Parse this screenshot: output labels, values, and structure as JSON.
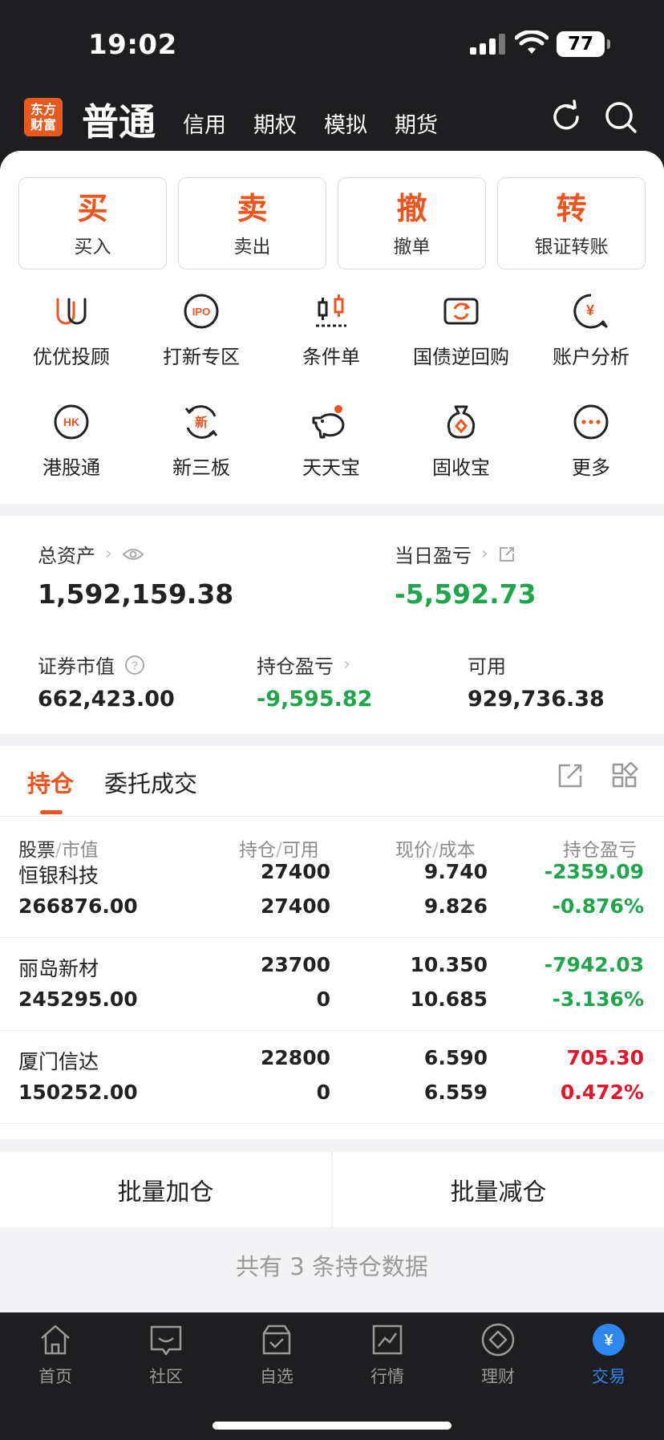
{
  "status": {
    "time": "19:02",
    "battery": "77"
  },
  "header": {
    "logo": [
      "东方",
      "财富"
    ],
    "active_tab": "普通",
    "tabs": [
      "信用",
      "期权",
      "模拟",
      "期货"
    ]
  },
  "quick_actions": [
    {
      "big": "买",
      "small": "买入"
    },
    {
      "big": "卖",
      "small": "卖出"
    },
    {
      "big": "撤",
      "small": "撤单"
    },
    {
      "big": "转",
      "small": "银证转账"
    }
  ],
  "functions": [
    {
      "label": "优优投顾",
      "icon": "youyou-icon"
    },
    {
      "label": "打新专区",
      "icon": "ipo-icon",
      "icon_text": "IPO"
    },
    {
      "label": "条件单",
      "icon": "candlestick-icon"
    },
    {
      "label": "国债逆回购",
      "icon": "repo-icon"
    },
    {
      "label": "账户分析",
      "icon": "account-analysis-icon",
      "icon_text": "¥"
    },
    {
      "label": "港股通",
      "icon": "hk-icon",
      "icon_text": "HK"
    },
    {
      "label": "新三板",
      "icon": "neeq-icon",
      "icon_text": "新"
    },
    {
      "label": "天天宝",
      "icon": "piggy-bank-icon"
    },
    {
      "label": "固收宝",
      "icon": "money-bag-icon"
    },
    {
      "label": "更多",
      "icon": "more-icon"
    }
  ],
  "assets": {
    "total_label": "总资产",
    "total_value": "1,592,159.38",
    "daily_pl_label": "当日盈亏",
    "daily_pl_value": "-5,592.73",
    "market_value_label": "证券市值",
    "market_value": "662,423.00",
    "position_pl_label": "持仓盈亏",
    "position_pl_value": "-9,595.82",
    "available_label": "可用",
    "available_value": "929,736.38"
  },
  "positions": {
    "tabs": [
      "持仓",
      "委托成交"
    ],
    "columns": {
      "c1a": "股票",
      "c1b": "市值",
      "c2a": "持仓",
      "c2b": "可用",
      "c3a": "现价",
      "c3b": "成本",
      "c4": "持仓盈亏"
    },
    "rows": [
      {
        "name": "恒银科技",
        "market_value": "266876.00",
        "hold": "27400",
        "available": "27400",
        "price": "9.740",
        "cost": "9.826",
        "pl": "-2359.09",
        "pl_pct": "-0.876%",
        "color": "#1fa64a"
      },
      {
        "name": "丽岛新材",
        "market_value": "245295.00",
        "hold": "23700",
        "available": "0",
        "price": "10.350",
        "cost": "10.685",
        "pl": "-7942.03",
        "pl_pct": "-3.136%",
        "color": "#1fa64a"
      },
      {
        "name": "厦门信达",
        "market_value": "150252.00",
        "hold": "22800",
        "available": "0",
        "price": "6.590",
        "cost": "6.559",
        "pl": "705.30",
        "pl_pct": "0.472%",
        "color": "#e6132b"
      }
    ]
  },
  "batch": {
    "add": "批量加仓",
    "reduce": "批量减仓"
  },
  "summary": "共有 3 条持仓数据",
  "nav": [
    {
      "label": "首页",
      "icon": "home-icon"
    },
    {
      "label": "社区",
      "icon": "community-icon"
    },
    {
      "label": "自选",
      "icon": "watchlist-icon"
    },
    {
      "label": "行情",
      "icon": "market-icon"
    },
    {
      "label": "理财",
      "icon": "wealth-icon"
    },
    {
      "label": "交易",
      "icon": "trade-icon",
      "active": true
    }
  ],
  "colors": {
    "accent": "#f0531c",
    "gain": "#e6132b",
    "loss": "#1fa64a",
    "nav_active": "#2e86f0"
  }
}
